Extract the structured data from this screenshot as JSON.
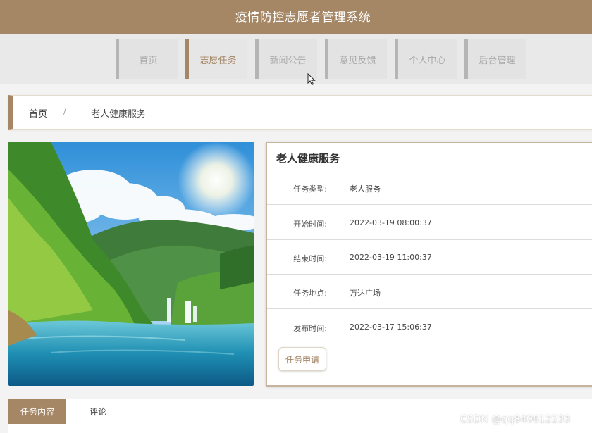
{
  "header": {
    "title": "疫情防控志愿者管理系统"
  },
  "nav": {
    "items": [
      {
        "label": "首页"
      },
      {
        "label": "志愿任务"
      },
      {
        "label": "新闻公告"
      },
      {
        "label": "意见反馈"
      },
      {
        "label": "个人中心"
      },
      {
        "label": "后台管理"
      }
    ],
    "active_index": 1
  },
  "breadcrumb": {
    "home": "首页",
    "separator": "/",
    "current": "老人健康服务"
  },
  "task": {
    "title": "老人健康服务",
    "fields": [
      {
        "label": "任务类型:",
        "value": "老人服务"
      },
      {
        "label": "开始时间:",
        "value": "2022-03-19 08:00:37"
      },
      {
        "label": "结束时间:",
        "value": "2022-03-19 11:00:37"
      },
      {
        "label": "任务地点:",
        "value": "万达广场"
      },
      {
        "label": "发布时间:",
        "value": "2022-03-17 15:06:37"
      }
    ],
    "apply_label": "任务申请"
  },
  "tabs": {
    "content_label": "任务内容",
    "comment_label": "评论"
  },
  "watermark": "CSDN @qq840612233",
  "colors": {
    "brand": "#a58766",
    "nav_inactive": "#b5b5b5"
  }
}
